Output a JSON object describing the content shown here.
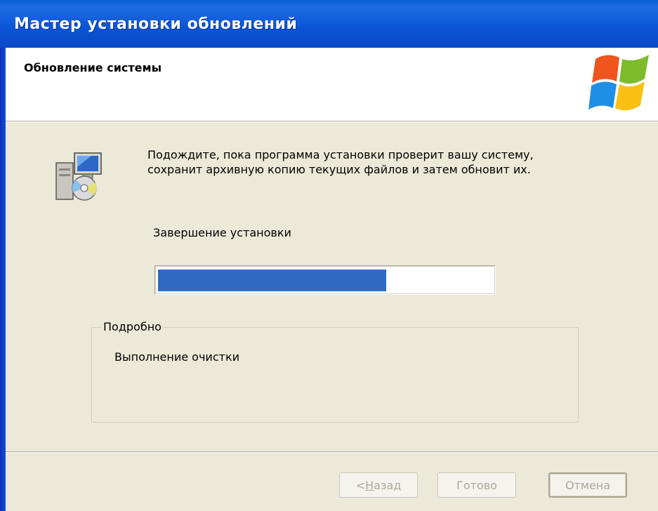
{
  "window": {
    "title": "Мастер установки обновлений"
  },
  "header": {
    "title": "Обновление системы"
  },
  "body": {
    "description_line1": "Подождите, пока программа установки проверит вашу систему,",
    "description_line2": "сохранит архивную копию текущих файлов и затем обновит их.",
    "status": "Завершение установки",
    "progress_fraction": 0.68
  },
  "details": {
    "legend": "Подробно",
    "text": "Выполнение очистки"
  },
  "buttons": {
    "back_prefix": "< ",
    "back_mnemonic": "Н",
    "back_rest": "азад",
    "finish": "Готово",
    "cancel": "Отмена"
  },
  "icons": {
    "logo": "windows-logo-icon",
    "setup": "setup-computer-cd-icon"
  },
  "colors": {
    "titlebar": "#0A53D6",
    "face": "#ECE9D8",
    "progress": "#316AC5"
  }
}
